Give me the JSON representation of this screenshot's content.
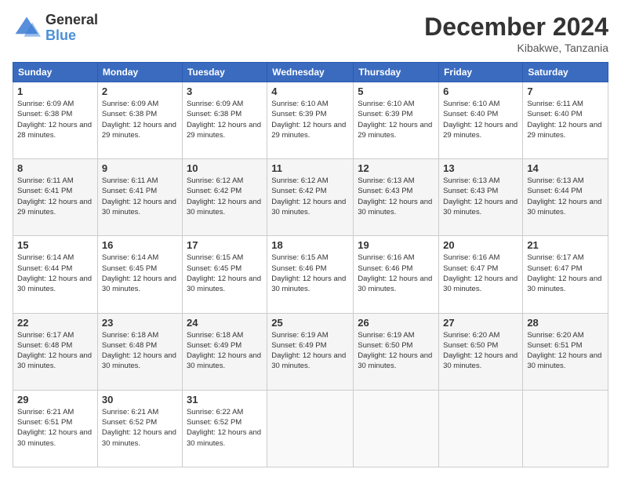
{
  "header": {
    "logo_general": "General",
    "logo_blue": "Blue",
    "month_title": "December 2024",
    "location": "Kibakwe, Tanzania"
  },
  "days_of_week": [
    "Sunday",
    "Monday",
    "Tuesday",
    "Wednesday",
    "Thursday",
    "Friday",
    "Saturday"
  ],
  "weeks": [
    [
      {
        "day": "1",
        "sunrise": "6:09 AM",
        "sunset": "6:38 PM",
        "daylight": "12 hours and 28 minutes."
      },
      {
        "day": "2",
        "sunrise": "6:09 AM",
        "sunset": "6:38 PM",
        "daylight": "12 hours and 29 minutes."
      },
      {
        "day": "3",
        "sunrise": "6:09 AM",
        "sunset": "6:38 PM",
        "daylight": "12 hours and 29 minutes."
      },
      {
        "day": "4",
        "sunrise": "6:10 AM",
        "sunset": "6:39 PM",
        "daylight": "12 hours and 29 minutes."
      },
      {
        "day": "5",
        "sunrise": "6:10 AM",
        "sunset": "6:39 PM",
        "daylight": "12 hours and 29 minutes."
      },
      {
        "day": "6",
        "sunrise": "6:10 AM",
        "sunset": "6:40 PM",
        "daylight": "12 hours and 29 minutes."
      },
      {
        "day": "7",
        "sunrise": "6:11 AM",
        "sunset": "6:40 PM",
        "daylight": "12 hours and 29 minutes."
      }
    ],
    [
      {
        "day": "8",
        "sunrise": "6:11 AM",
        "sunset": "6:41 PM",
        "daylight": "12 hours and 29 minutes."
      },
      {
        "day": "9",
        "sunrise": "6:11 AM",
        "sunset": "6:41 PM",
        "daylight": "12 hours and 30 minutes."
      },
      {
        "day": "10",
        "sunrise": "6:12 AM",
        "sunset": "6:42 PM",
        "daylight": "12 hours and 30 minutes."
      },
      {
        "day": "11",
        "sunrise": "6:12 AM",
        "sunset": "6:42 PM",
        "daylight": "12 hours and 30 minutes."
      },
      {
        "day": "12",
        "sunrise": "6:13 AM",
        "sunset": "6:43 PM",
        "daylight": "12 hours and 30 minutes."
      },
      {
        "day": "13",
        "sunrise": "6:13 AM",
        "sunset": "6:43 PM",
        "daylight": "12 hours and 30 minutes."
      },
      {
        "day": "14",
        "sunrise": "6:13 AM",
        "sunset": "6:44 PM",
        "daylight": "12 hours and 30 minutes."
      }
    ],
    [
      {
        "day": "15",
        "sunrise": "6:14 AM",
        "sunset": "6:44 PM",
        "daylight": "12 hours and 30 minutes."
      },
      {
        "day": "16",
        "sunrise": "6:14 AM",
        "sunset": "6:45 PM",
        "daylight": "12 hours and 30 minutes."
      },
      {
        "day": "17",
        "sunrise": "6:15 AM",
        "sunset": "6:45 PM",
        "daylight": "12 hours and 30 minutes."
      },
      {
        "day": "18",
        "sunrise": "6:15 AM",
        "sunset": "6:46 PM",
        "daylight": "12 hours and 30 minutes."
      },
      {
        "day": "19",
        "sunrise": "6:16 AM",
        "sunset": "6:46 PM",
        "daylight": "12 hours and 30 minutes."
      },
      {
        "day": "20",
        "sunrise": "6:16 AM",
        "sunset": "6:47 PM",
        "daylight": "12 hours and 30 minutes."
      },
      {
        "day": "21",
        "sunrise": "6:17 AM",
        "sunset": "6:47 PM",
        "daylight": "12 hours and 30 minutes."
      }
    ],
    [
      {
        "day": "22",
        "sunrise": "6:17 AM",
        "sunset": "6:48 PM",
        "daylight": "12 hours and 30 minutes."
      },
      {
        "day": "23",
        "sunrise": "6:18 AM",
        "sunset": "6:48 PM",
        "daylight": "12 hours and 30 minutes."
      },
      {
        "day": "24",
        "sunrise": "6:18 AM",
        "sunset": "6:49 PM",
        "daylight": "12 hours and 30 minutes."
      },
      {
        "day": "25",
        "sunrise": "6:19 AM",
        "sunset": "6:49 PM",
        "daylight": "12 hours and 30 minutes."
      },
      {
        "day": "26",
        "sunrise": "6:19 AM",
        "sunset": "6:50 PM",
        "daylight": "12 hours and 30 minutes."
      },
      {
        "day": "27",
        "sunrise": "6:20 AM",
        "sunset": "6:50 PM",
        "daylight": "12 hours and 30 minutes."
      },
      {
        "day": "28",
        "sunrise": "6:20 AM",
        "sunset": "6:51 PM",
        "daylight": "12 hours and 30 minutes."
      }
    ],
    [
      {
        "day": "29",
        "sunrise": "6:21 AM",
        "sunset": "6:51 PM",
        "daylight": "12 hours and 30 minutes."
      },
      {
        "day": "30",
        "sunrise": "6:21 AM",
        "sunset": "6:52 PM",
        "daylight": "12 hours and 30 minutes."
      },
      {
        "day": "31",
        "sunrise": "6:22 AM",
        "sunset": "6:52 PM",
        "daylight": "12 hours and 30 minutes."
      },
      null,
      null,
      null,
      null
    ]
  ]
}
